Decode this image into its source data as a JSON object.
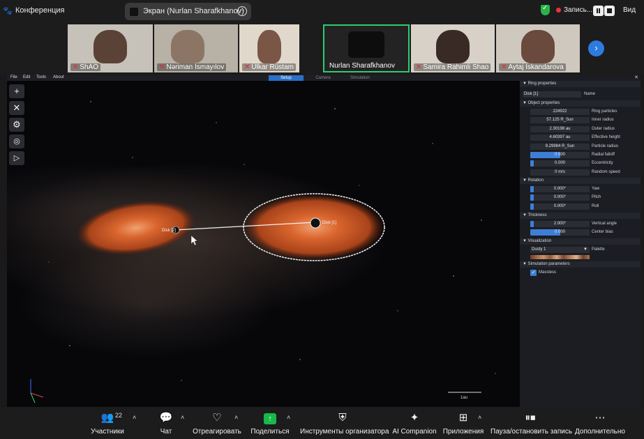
{
  "topbar": {
    "app_title": "Конференция",
    "share_label": "Экран (Nurlan Sharafkhanov)",
    "recording_label": "Запись...",
    "view_label": "Вид"
  },
  "participants": [
    {
      "name": "ShAO",
      "muted": true
    },
    {
      "name": "Nəriman İsmayılov",
      "muted": true
    },
    {
      "name": "Ülkar Rüstam",
      "muted": true
    },
    {
      "name": "Nurlan Sharafkhanov",
      "muted": false,
      "active": true
    },
    {
      "name": "Samira Rahimli Shao",
      "muted": true
    },
    {
      "name": "Aytaj Iskandarova",
      "muted": true
    }
  ],
  "app": {
    "menu": [
      "File",
      "Edit",
      "Tools",
      "About"
    ],
    "modes": [
      "Setup",
      "Camera",
      "Simulation"
    ],
    "active_mode": "Setup",
    "scale_label": "1au",
    "disk1_label": "Disk [1]",
    "disk2_label": "Disk [2]"
  },
  "panel": {
    "title": "Ring properties",
    "object_name": "Disk [1]",
    "name_label": "Name",
    "sections": {
      "object": "Object properties",
      "rotation": "Rotation",
      "thickness": "Thickness",
      "visualization": "Visualization",
      "simulation": "Simulation parameters"
    },
    "object_props": [
      {
        "value": "224922",
        "label": "Ring particles",
        "fill": 0
      },
      {
        "value": "57.125 R_Sun",
        "label": "Inner radius",
        "fill": 0
      },
      {
        "value": "2.30198 au",
        "label": "Outer radius",
        "fill": 0
      },
      {
        "value": "4.60397 au",
        "label": "Effective height",
        "fill": 0
      },
      {
        "value": "9.29984 R_Sun",
        "label": "Particle radius",
        "fill": 0
      },
      {
        "value": "0.500",
        "label": "Radial falloff",
        "fill": 0.5
      },
      {
        "value": "0.000",
        "label": "Eccentricity",
        "fill": 0.06
      },
      {
        "value": "0 m/s",
        "label": "Random speed",
        "fill": 0
      }
    ],
    "rotation_props": [
      {
        "value": "0.000°",
        "label": "Yaw",
        "fill": 0.06
      },
      {
        "value": "0.000°",
        "label": "Pitch",
        "fill": 0.06
      },
      {
        "value": "0.000°",
        "label": "Roll",
        "fill": 0.06
      }
    ],
    "thickness_props": [
      {
        "value": "2.000°",
        "label": "Vertical angle",
        "fill": 0.06
      },
      {
        "value": "0.000",
        "label": "Center bias",
        "fill": 0.5
      }
    ],
    "palette_value": "Dusty 1",
    "palette_label": "Palette",
    "massless_label": "Massless",
    "massless_checked": true
  },
  "toolbar": [
    {
      "label": "Участники",
      "icon": "participants-icon",
      "count": "22"
    },
    {
      "label": "Чат",
      "icon": "chat-icon"
    },
    {
      "label": "Отреагировать",
      "icon": "heart-icon"
    },
    {
      "label": "Поделиться",
      "icon": "share-screen-icon"
    },
    {
      "label": "Инструменты организатора",
      "icon": "shield-icon"
    },
    {
      "label": "AI Companion",
      "icon": "sparkle-icon"
    },
    {
      "label": "Приложения",
      "icon": "apps-icon"
    },
    {
      "label": "Пауза/остановить запись",
      "icon": "pause-stop-icon"
    },
    {
      "label": "Дополнительно",
      "icon": "more-icon"
    }
  ],
  "colors": {
    "accent_blue": "#2c6fc6",
    "active_green": "#2ecc71",
    "share_green": "#18b84a",
    "recording_red": "#e33333",
    "disk_orange": "#c8501c"
  }
}
